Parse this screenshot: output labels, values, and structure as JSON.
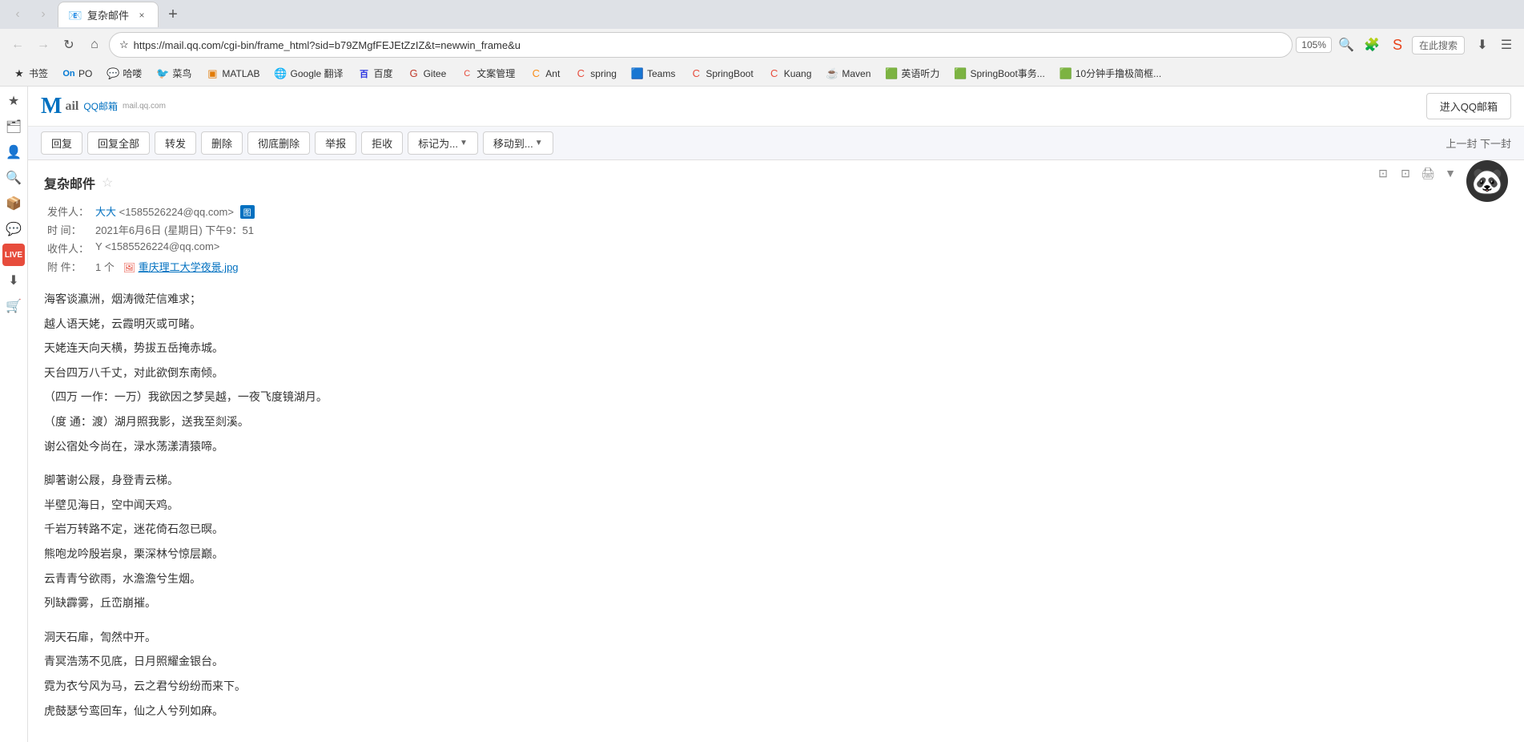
{
  "browser": {
    "tab": {
      "favicon": "📧",
      "title": "复杂邮件",
      "close_label": "×"
    },
    "nav": {
      "back_disabled": true,
      "forward_disabled": true,
      "refresh": "↻",
      "home": "⌂"
    },
    "address": {
      "url": "https://mail.qq.com/cgi-bin/frame_html?sid=b79ZMgfFEJEtZzIZ&t=newwin_frame&u",
      "star_icon": "☆",
      "zoom": "105%"
    },
    "bookmarks": [
      {
        "id": "bk-shujian",
        "icon": "★",
        "label": "书签"
      },
      {
        "id": "bk-po",
        "icon": "📋",
        "label": "PO"
      },
      {
        "id": "bk-hushuo",
        "icon": "💬",
        "label": "哈喽"
      },
      {
        "id": "bk-caoniao",
        "icon": "🐦",
        "label": "菜鸟"
      },
      {
        "id": "bk-matlab",
        "icon": "📊",
        "label": "MATLAB"
      },
      {
        "id": "bk-google",
        "icon": "🌐",
        "label": "Google 翻译"
      },
      {
        "id": "bk-baidu",
        "icon": "🔍",
        "label": "百度"
      },
      {
        "id": "bk-gitee",
        "icon": "🦊",
        "label": "Gitee"
      },
      {
        "id": "bk-wenku",
        "icon": "📄",
        "label": "文案管理"
      },
      {
        "id": "bk-ant",
        "icon": "🐜",
        "label": "Ant"
      },
      {
        "id": "bk-spring",
        "icon": "🍃",
        "label": "spring"
      },
      {
        "id": "bk-teams",
        "icon": "🟦",
        "label": "Teams"
      },
      {
        "id": "bk-springboot",
        "icon": "🟧",
        "label": "SpringBoot"
      },
      {
        "id": "bk-kuang",
        "icon": "🟧",
        "label": "Kuang"
      },
      {
        "id": "bk-maven",
        "icon": "☕",
        "label": "Maven"
      },
      {
        "id": "bk-english",
        "icon": "🟩",
        "label": "英语听力"
      },
      {
        "id": "bk-springboot2",
        "icon": "🟧",
        "label": "SpringBoot事务..."
      },
      {
        "id": "bk-10min",
        "icon": "🟩",
        "label": "10分钟手撸极简框..."
      }
    ],
    "sidebar_icons": [
      "★",
      "🗂",
      "👤",
      "🔍",
      "📦",
      "💬",
      "📅",
      "LIVE",
      "⬇",
      "🛒"
    ]
  },
  "email": {
    "enter_qq_btn": "进入QQ邮箱",
    "toolbar": {
      "reply": "回复",
      "reply_all": "回复全部",
      "forward": "转发",
      "delete": "删除",
      "delete_permanently": "彻底删除",
      "report": "举报",
      "reject": "拒收",
      "mark_as": "标记为...",
      "move_to": "移动到...",
      "prev_next": "上一封 下一封"
    },
    "subject": "复杂邮件",
    "star": "☆",
    "meta": {
      "from_label": "发件人：",
      "from_name": "大大",
      "from_email": "<1585526224@qq.com>",
      "from_icon": "图",
      "time_label": "时  间：",
      "time_value": "2021年6月6日 (星期日) 下午9：51",
      "to_label": "收件人：",
      "to_value": "Y <1585526224@qq.com>",
      "attach_label": "附  件：",
      "attach_count": "1 个",
      "attach_file": "重庆理工大学夜景.jpg"
    },
    "header_tools": [
      "⊡",
      "⊡",
      "🖨",
      "▼"
    ],
    "content": [
      "海客谈瀛洲，烟涛微茫信难求；",
      "越人语天姥，云霞明灭或可睹。",
      "天姥连天向天横，势拔五岳掩赤城。",
      "天台四万八千丈，对此欲倒东南倾。",
      "（四万 一作：一万）我欲因之梦吴越，一夜飞度镜湖月。",
      "（度 通：渡）湖月照我影，送我至剡溪。",
      "谢公宿处今尚在，渌水荡漾清猿啼。",
      "",
      "脚著谢公屐，身登青云梯。",
      "半壁见海日，空中闻天鸡。",
      "千岩万转路不定，迷花倚石忽已暝。",
      "熊咆龙吟殷岩泉，栗深林兮惊层巅。",
      "云青青兮欲雨，水澹澹兮生烟。",
      "列缺霹雾，丘峦崩摧。",
      "",
      "洞天石扉，訇然中开。",
      "青冥浩荡不见底，日月照耀金银台。",
      "霓为衣兮风为马，云之君兮纷纷而来下。",
      "虎鼓瑟兮鸾回车，仙之人兮列如麻。"
    ]
  }
}
